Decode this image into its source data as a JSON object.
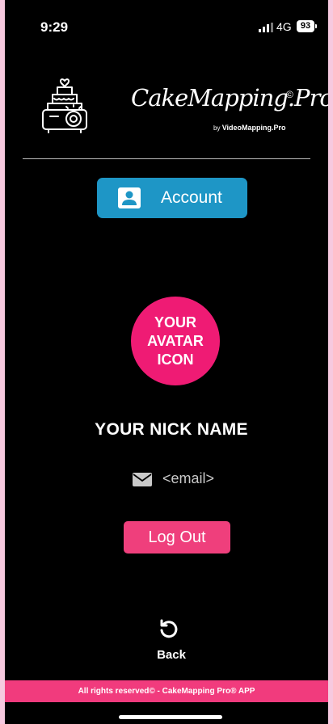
{
  "status_bar": {
    "time": "9:29",
    "network": "4G",
    "battery": "93"
  },
  "header": {
    "brand_name": "CakeMapping.Pro",
    "brand_registered": "©",
    "brand_by": "by",
    "brand_sub": "VideoMapping.Pro",
    "logo_icon": "cake-projector-icon"
  },
  "account_button": {
    "label": "Account",
    "icon": "user-card-icon"
  },
  "profile": {
    "avatar_text": "YOUR AVATAR ICON",
    "nickname": "YOUR NICK NAME",
    "email_icon": "envelope-icon",
    "email": "<email>"
  },
  "logout_button": {
    "label": "Log Out"
  },
  "back": {
    "label": "Back",
    "icon": "undo-arrow-icon"
  },
  "footer": {
    "text": "All rights reserved© - CakeMapping Pro® APP"
  },
  "colors": {
    "background": "#000000",
    "account_blue": "#1e96c6",
    "pink": "#ef1b74",
    "footer_pink": "#f13b7d",
    "page_border": "#f6c9df"
  }
}
